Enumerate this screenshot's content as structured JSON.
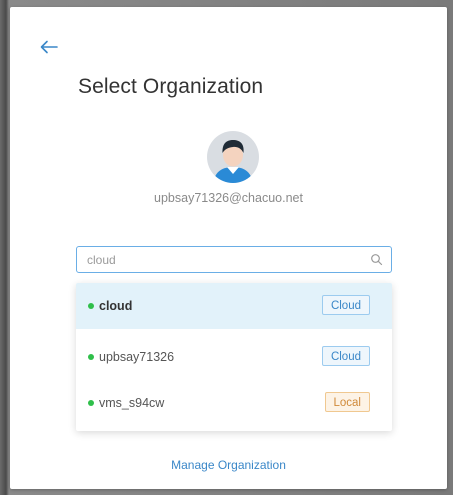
{
  "header": {
    "back_icon": "arrow-left-icon",
    "title": "Select Organization"
  },
  "user": {
    "avatar_icon": "user-avatar-icon",
    "email": "upbsay71326@chacuo.net"
  },
  "search": {
    "value": "cloud",
    "icon": "search-icon"
  },
  "organizations": [
    {
      "name": "cloud",
      "type": "Cloud",
      "status_color": "#2fbf4a",
      "selected": true
    },
    {
      "name": "upbsay71326",
      "type": "Cloud",
      "status_color": "#2fbf4a",
      "selected": false
    },
    {
      "name": "vms_s94cw",
      "type": "Local",
      "status_color": "#2fbf4a",
      "selected": false
    }
  ],
  "footer": {
    "manage_label": "Manage Organization"
  },
  "colors": {
    "accent": "#3a87c8",
    "selected_row": "#e2f2fa",
    "status_online": "#2fbf4a",
    "local_badge": "#d08a3a"
  }
}
